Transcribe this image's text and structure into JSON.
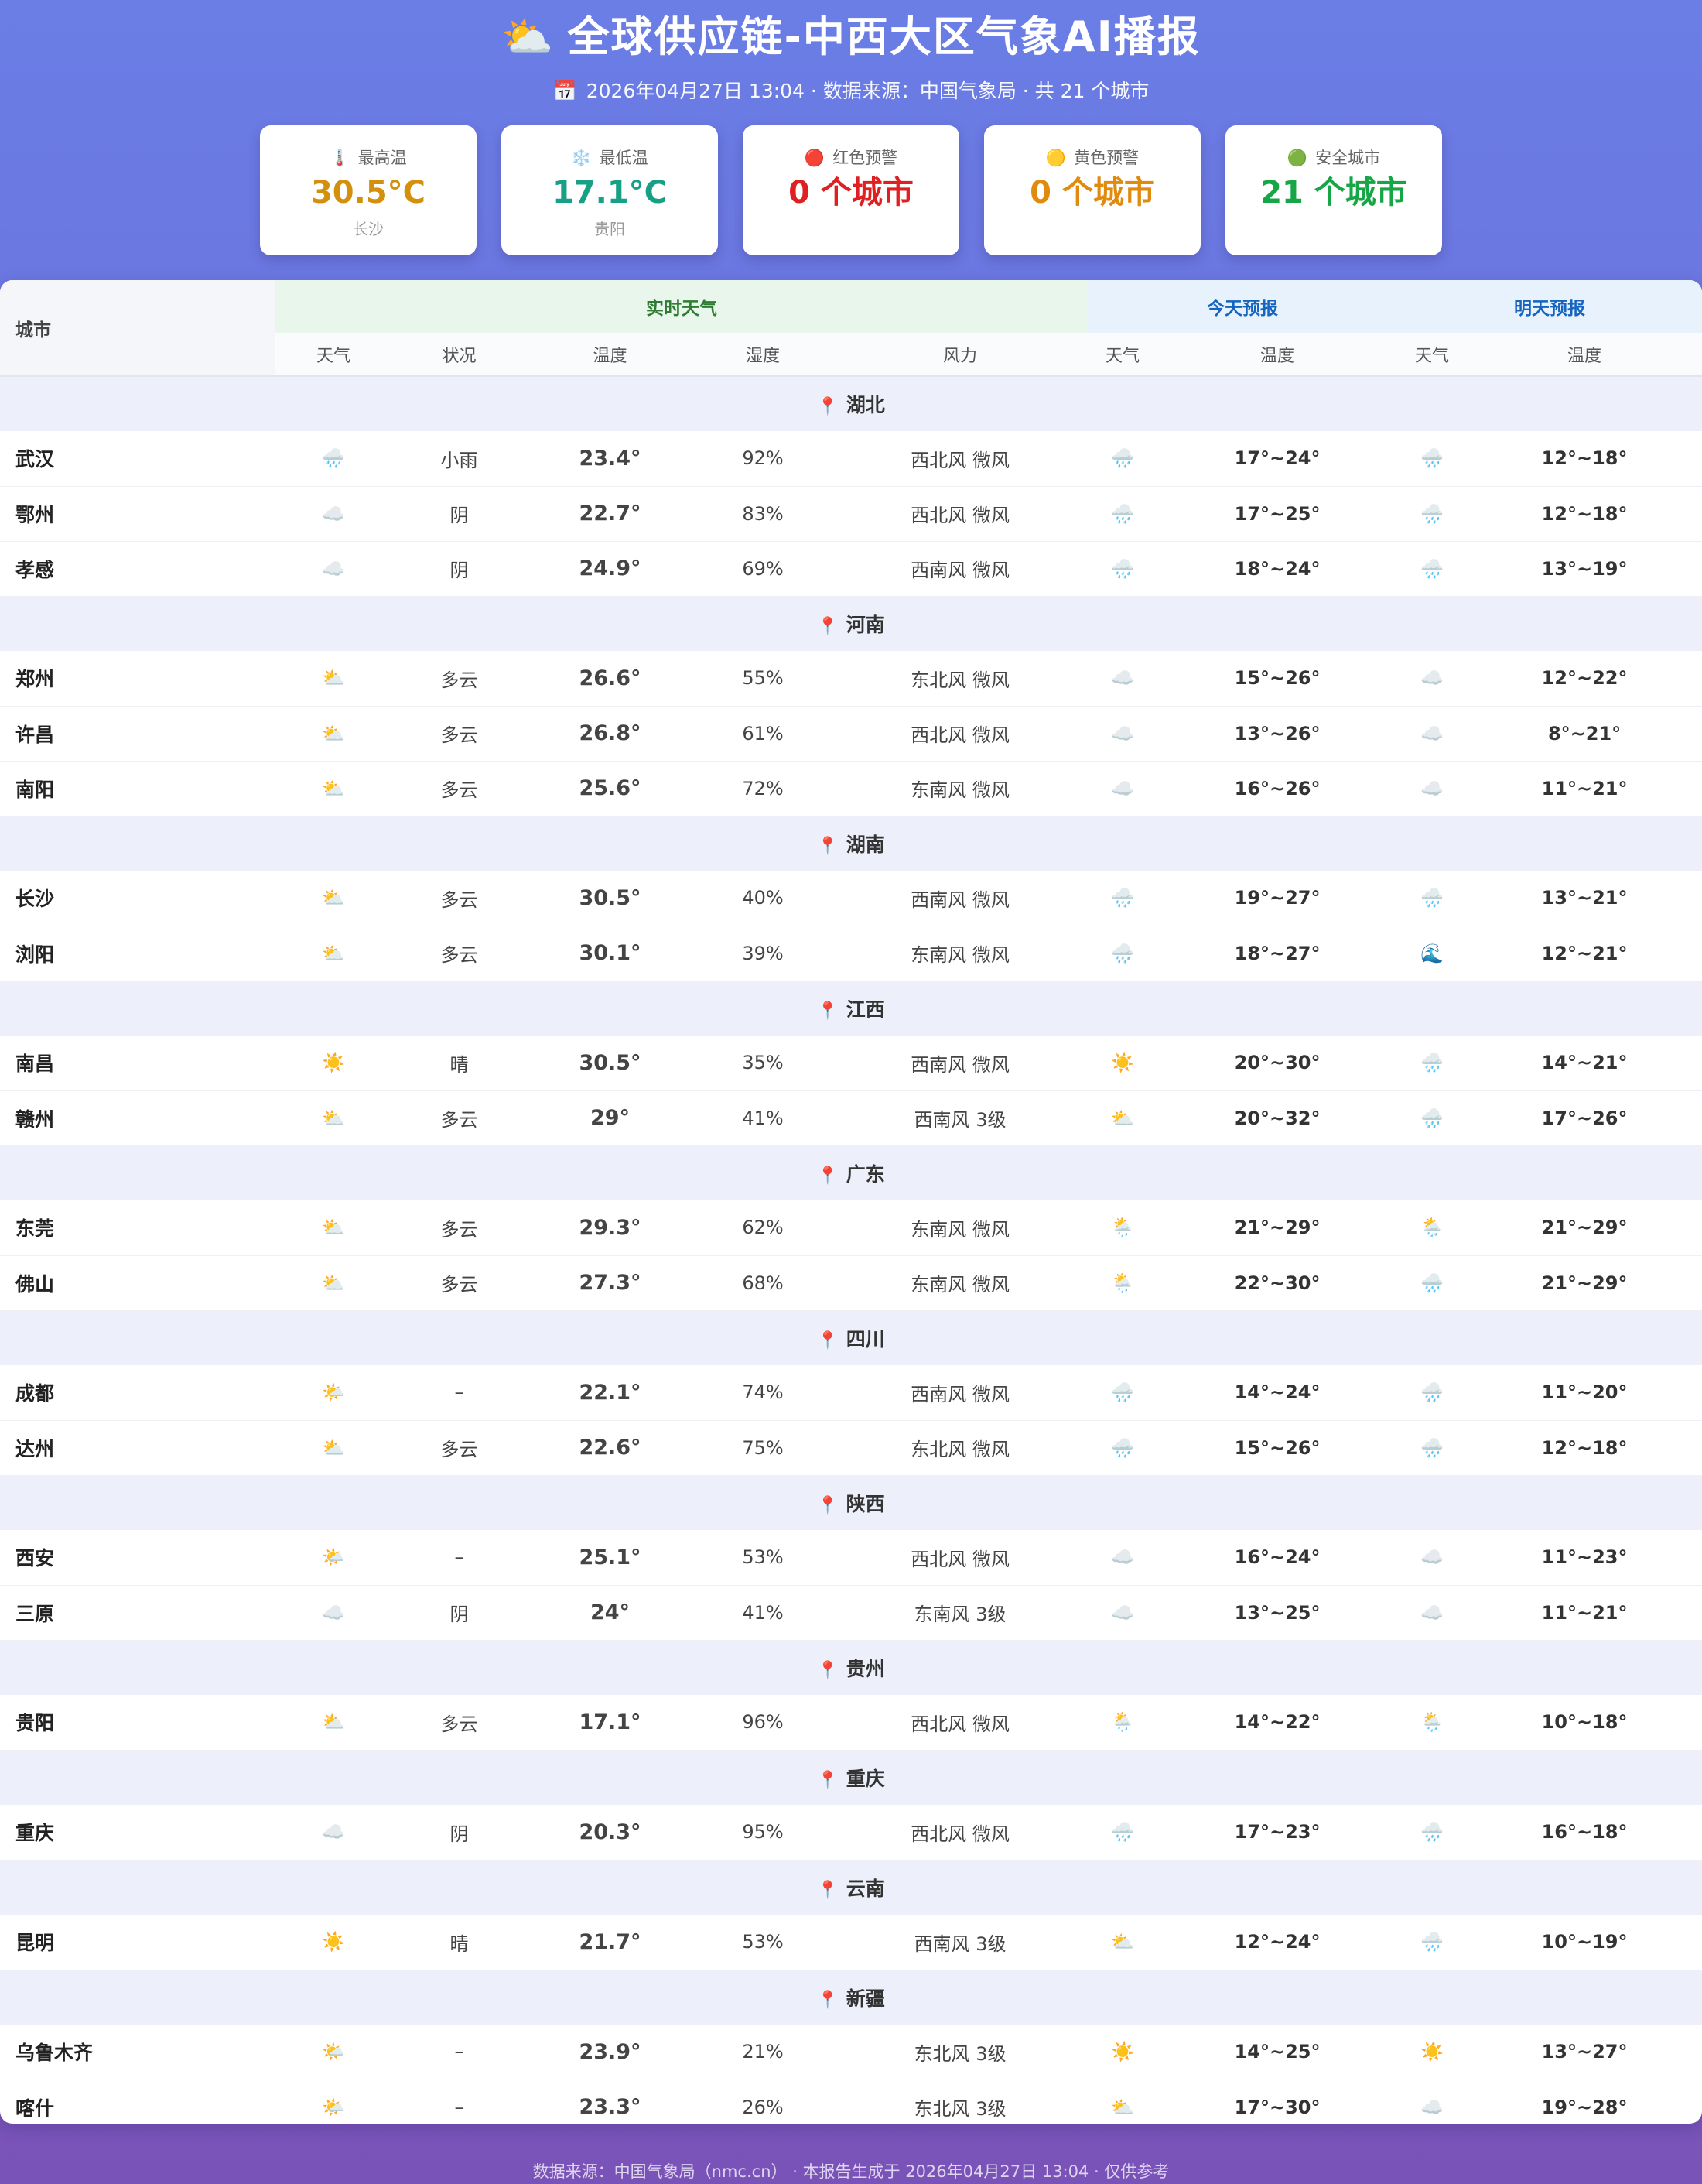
{
  "header": {
    "title_icon": "⛅",
    "title": "全球供应链-中西大区气象AI播报",
    "calendar_icon": "📅",
    "subtitle": "2026年04月27日 13:04 · 数据来源：中国气象局 · 共 21 个城市"
  },
  "cards": [
    {
      "icon": "🌡️",
      "label": "最高温",
      "value": "30.5°C",
      "sub": "长沙",
      "color": "#d4900d"
    },
    {
      "icon": "❄️",
      "label": "最低温",
      "value": "17.1°C",
      "sub": "贵阳",
      "color": "#18a087"
    },
    {
      "icon": "🔴",
      "label": "红色预警",
      "value": "0 个城市",
      "sub": "",
      "color": "#e02020"
    },
    {
      "icon": "🟡",
      "label": "黄色预警",
      "value": "0 个城市",
      "sub": "",
      "color": "#e08a0e"
    },
    {
      "icon": "🟢",
      "label": "安全城市",
      "value": "21 个城市",
      "sub": "",
      "color": "#17a646"
    }
  ],
  "table": {
    "city_header": "城市",
    "group_realtime": "实时天气",
    "group_today": "今天预报",
    "group_tomorrow": "明天预报",
    "sub_headers": [
      "天气",
      "状况",
      "温度",
      "湿度",
      "风力",
      "天气",
      "温度",
      "天气",
      "温度"
    ],
    "provinces": [
      {
        "name": "湖北",
        "rows": [
          {
            "city": "武汉",
            "icon": "🌧️",
            "cond": "小雨",
            "temp": "23.4°",
            "tc": "teal",
            "hum": "92%",
            "wind": "西北风 微风",
            "t_icon": "🌧️",
            "t_temp": "17°~24°",
            "m_icon": "🌧️",
            "m_temp": "12°~18°"
          },
          {
            "city": "鄂州",
            "icon": "☁️",
            "cond": "阴",
            "temp": "22.7°",
            "tc": "teal",
            "hum": "83%",
            "wind": "西北风 微风",
            "t_icon": "🌧️",
            "t_temp": "17°~25°",
            "m_icon": "🌧️",
            "m_temp": "12°~18°"
          },
          {
            "city": "孝感",
            "icon": "☁️",
            "cond": "阴",
            "temp": "24.9°",
            "tc": "teal",
            "hum": "69%",
            "wind": "西南风 微风",
            "t_icon": "🌧️",
            "t_temp": "18°~24°",
            "m_icon": "🌧️",
            "m_temp": "13°~19°"
          }
        ]
      },
      {
        "name": "河南",
        "rows": [
          {
            "city": "郑州",
            "icon": "⛅",
            "cond": "多云",
            "temp": "26.6°",
            "tc": "green",
            "hum": "55%",
            "wind": "东北风 微风",
            "t_icon": "☁️",
            "t_temp": "15°~26°",
            "m_icon": "☁️",
            "m_temp": "12°~22°"
          },
          {
            "city": "许昌",
            "icon": "⛅",
            "cond": "多云",
            "temp": "26.8°",
            "tc": "green",
            "hum": "61%",
            "wind": "西北风 微风",
            "t_icon": "☁️",
            "t_temp": "13°~26°",
            "m_icon": "☁️",
            "m_temp": "8°~21°"
          },
          {
            "city": "南阳",
            "icon": "⛅",
            "cond": "多云",
            "temp": "25.6°",
            "tc": "green",
            "hum": "72%",
            "wind": "东南风 微风",
            "t_icon": "☁️",
            "t_temp": "16°~26°",
            "m_icon": "☁️",
            "m_temp": "11°~21°"
          }
        ]
      },
      {
        "name": "湖南",
        "rows": [
          {
            "city": "长沙",
            "icon": "⛅",
            "cond": "多云",
            "temp": "30.5°",
            "tc": "orange",
            "hum": "40%",
            "wind": "西南风 微风",
            "t_icon": "🌧️",
            "t_temp": "19°~27°",
            "m_icon": "🌧️",
            "m_temp": "13°~21°"
          },
          {
            "city": "浏阳",
            "icon": "⛅",
            "cond": "多云",
            "temp": "30.1°",
            "tc": "orange",
            "hum": "39%",
            "wind": "东南风 微风",
            "t_icon": "🌧️",
            "t_temp": "18°~27°",
            "m_icon": "🌊",
            "m_temp": "12°~21°"
          }
        ]
      },
      {
        "name": "江西",
        "rows": [
          {
            "city": "南昌",
            "icon": "☀️",
            "cond": "晴",
            "temp": "30.5°",
            "tc": "orange",
            "hum": "35%",
            "wind": "西南风 微风",
            "t_icon": "☀️",
            "t_temp": "20°~30°",
            "m_icon": "🌧️",
            "m_temp": "14°~21°"
          },
          {
            "city": "赣州",
            "icon": "⛅",
            "cond": "多云",
            "temp": "29°",
            "tc": "green",
            "hum": "41%",
            "wind": "西南风 3级",
            "t_icon": "⛅",
            "t_temp": "20°~32°",
            "m_icon": "🌧️",
            "m_temp": "17°~26°"
          }
        ]
      },
      {
        "name": "广东",
        "rows": [
          {
            "city": "东莞",
            "icon": "⛅",
            "cond": "多云",
            "temp": "29.3°",
            "tc": "green",
            "hum": "62%",
            "wind": "东南风 微风",
            "t_icon": "🌦️",
            "t_temp": "21°~29°",
            "m_icon": "🌦️",
            "m_temp": "21°~29°"
          },
          {
            "city": "佛山",
            "icon": "⛅",
            "cond": "多云",
            "temp": "27.3°",
            "tc": "green",
            "hum": "68%",
            "wind": "东南风 微风",
            "t_icon": "🌦️",
            "t_temp": "22°~30°",
            "m_icon": "🌧️",
            "m_temp": "21°~29°"
          }
        ]
      },
      {
        "name": "四川",
        "rows": [
          {
            "city": "成都",
            "icon": "🌤️",
            "cond": "–",
            "temp": "22.1°",
            "tc": "teal",
            "hum": "74%",
            "wind": "西南风 微风",
            "t_icon": "🌧️",
            "t_temp": "14°~24°",
            "m_icon": "🌧️",
            "m_temp": "11°~20°"
          },
          {
            "city": "达州",
            "icon": "⛅",
            "cond": "多云",
            "temp": "22.6°",
            "tc": "teal",
            "hum": "75%",
            "wind": "东北风 微风",
            "t_icon": "🌧️",
            "t_temp": "15°~26°",
            "m_icon": "🌧️",
            "m_temp": "12°~18°"
          }
        ]
      },
      {
        "name": "陕西",
        "rows": [
          {
            "city": "西安",
            "icon": "🌤️",
            "cond": "–",
            "temp": "25.1°",
            "tc": "green",
            "hum": "53%",
            "wind": "西北风 微风",
            "t_icon": "☁️",
            "t_temp": "16°~24°",
            "m_icon": "☁️",
            "m_temp": "11°~23°"
          },
          {
            "city": "三原",
            "icon": "☁️",
            "cond": "阴",
            "temp": "24°",
            "tc": "teal",
            "hum": "41%",
            "wind": "东南风 3级",
            "t_icon": "☁️",
            "t_temp": "13°~25°",
            "m_icon": "☁️",
            "m_temp": "11°~21°"
          }
        ]
      },
      {
        "name": "贵州",
        "rows": [
          {
            "city": "贵阳",
            "icon": "⛅",
            "cond": "多云",
            "temp": "17.1°",
            "tc": "teal",
            "hum": "96%",
            "wind": "西北风 微风",
            "t_icon": "🌦️",
            "t_temp": "14°~22°",
            "m_icon": "🌦️",
            "m_temp": "10°~18°"
          }
        ]
      },
      {
        "name": "重庆",
        "rows": [
          {
            "city": "重庆",
            "icon": "☁️",
            "cond": "阴",
            "temp": "20.3°",
            "tc": "teal",
            "hum": "95%",
            "wind": "西北风 微风",
            "t_icon": "🌧️",
            "t_temp": "17°~23°",
            "m_icon": "🌧️",
            "m_temp": "16°~18°"
          }
        ]
      },
      {
        "name": "云南",
        "rows": [
          {
            "city": "昆明",
            "icon": "☀️",
            "cond": "晴",
            "temp": "21.7°",
            "tc": "teal",
            "hum": "53%",
            "wind": "西南风 3级",
            "t_icon": "⛅",
            "t_temp": "12°~24°",
            "m_icon": "🌧️",
            "m_temp": "10°~19°"
          }
        ]
      },
      {
        "name": "新疆",
        "rows": [
          {
            "city": "乌鲁木齐",
            "icon": "🌤️",
            "cond": "–",
            "temp": "23.9°",
            "tc": "teal",
            "hum": "21%",
            "wind": "东北风 3级",
            "t_icon": "☀️",
            "t_temp": "14°~25°",
            "m_icon": "☀️",
            "m_temp": "13°~27°"
          },
          {
            "city": "喀什",
            "icon": "🌤️",
            "cond": "–",
            "temp": "23.3°",
            "tc": "teal",
            "hum": "26%",
            "wind": "东北风 3级",
            "t_icon": "⛅",
            "t_temp": "17°~30°",
            "m_icon": "☁️",
            "m_temp": "19°~28°"
          }
        ]
      }
    ]
  },
  "footer": "数据来源：中国气象局（nmc.cn） · 本报告生成于 2026年04月27日 13:04 · 仅供参考"
}
